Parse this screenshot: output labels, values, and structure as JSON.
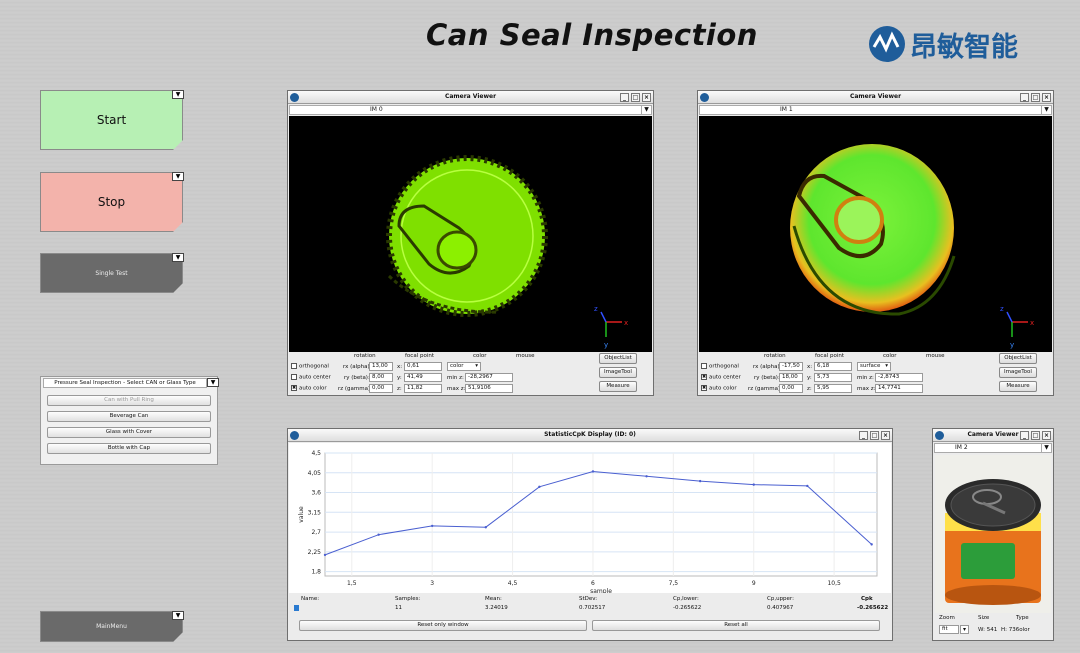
{
  "header": {
    "title": "Can Seal Inspection",
    "logo_text": "昂敏智能"
  },
  "left_buttons": {
    "start": "Start",
    "stop": "Stop",
    "single_test": "Single Test",
    "main_menu": "MainMenu",
    "dropdown_glyph": "▼"
  },
  "colors": {
    "start": "#b7f0b4",
    "stop": "#f3b3ab",
    "dark_button": "#6a6a6a",
    "accent": "#1f5d9a",
    "plot_line": "#4a5fd0"
  },
  "camera_viewer_1": {
    "title": "Camera Viewer",
    "image": "IM 0",
    "labels": {
      "rotation": "rotation",
      "focal_point": "focal point",
      "color": "color",
      "mouse": "mouse"
    },
    "checks": [
      {
        "label": "orthogonal",
        "checked": false,
        "mark": ""
      },
      {
        "label": "auto center",
        "checked": false,
        "mark": ""
      },
      {
        "label": "auto color",
        "checked": true,
        "mark": "✖"
      }
    ],
    "rx_label": "rx (alpha):",
    "rx": "13,00",
    "ry_label": "ry (beta):",
    "ry": "8,00",
    "rz_label": "rz (gamma):",
    "rz": "0,00",
    "x_label": "x:",
    "x": "0,61",
    "y_label": "y:",
    "y": "41,49",
    "z_label": "z:",
    "z": "11,82",
    "color_mode": "color",
    "min_z_label": "min z:",
    "min_z": "-28,2967",
    "max_z_label": "max z:",
    "max_z": "51,9106",
    "buttons": [
      "ObjectList",
      "ImageTool",
      "Measure"
    ]
  },
  "camera_viewer_2": {
    "title": "Camera Viewer",
    "image": "IM 1",
    "labels": {
      "rotation": "rotation",
      "focal_point": "focal point",
      "color": "color",
      "mouse": "mouse"
    },
    "checks": [
      {
        "label": "orthogonal",
        "checked": false,
        "mark": ""
      },
      {
        "label": "auto center",
        "checked": true,
        "mark": "✖"
      },
      {
        "label": "auto color",
        "checked": true,
        "mark": "✖"
      }
    ],
    "rx_label": "rx (alpha):",
    "rx": "-17,50",
    "ry_label": "ry (beta):",
    "ry": "18,00",
    "rz_label": "rz (gamma):",
    "rz": "0,00",
    "x_label": "x:",
    "x": "6,18",
    "y_label": "y:",
    "y": "5,73",
    "z_label": "z:",
    "z": "5,95",
    "color_mode": "surface",
    "min_z_label": "min z:",
    "min_z": "-2,8743",
    "max_z_label": "max z:",
    "max_z": "14,7741",
    "buttons": [
      "ObjectList",
      "ImageTool",
      "Measure"
    ]
  },
  "camera_viewer_3": {
    "title": "Camera Viewer",
    "image": "IM 2",
    "zoom_label": "Zoom",
    "zoom": "fit",
    "size_label": "Size",
    "size": "W: 541",
    "type_label": "Type",
    "type": "H: 736olor"
  },
  "axis_glyphs": {
    "x": "x",
    "y": "y",
    "z": "z"
  },
  "glyphs": {
    "minimize": "_",
    "maximize": "□",
    "close": "×",
    "dropdown": "▾"
  },
  "seal_panel": {
    "title": "Pressure Seal Inspection - Select CAN or Glass Type",
    "items": [
      {
        "label": "Can with Pull Ring",
        "disabled": true
      },
      {
        "label": "Beverage Can",
        "disabled": false
      },
      {
        "label": "Glass with Cover",
        "disabled": false
      },
      {
        "label": "Bottle with Cap",
        "disabled": false
      }
    ]
  },
  "stats": {
    "title": "StatisticCpK Display  (ID: 0)",
    "headers": [
      "Name:",
      "Samples:",
      "Mean:",
      "StDev:",
      "Cp,lower:",
      "Cp,upper:",
      "Cpk"
    ],
    "values": [
      "",
      "11",
      "3.24019",
      "0.702517",
      "-0.265622",
      "0.407967",
      "-0.265622"
    ],
    "reset_window": "Reset only window",
    "reset_all": "Reset all"
  },
  "chart_data": {
    "type": "line",
    "xlabel": "sample",
    "ylabel": "value",
    "xlim": [
      1,
      11.3
    ],
    "ylim": [
      1.7,
      4.5
    ],
    "xticks": [
      1.5,
      3,
      4.5,
      6,
      7.5,
      9,
      10.5
    ],
    "xtick_labels": [
      "1,5",
      "3",
      "4,5",
      "6",
      "7,5",
      "9",
      "10,5"
    ],
    "yticks": [
      1.8,
      2.25,
      2.7,
      3.15,
      3.6,
      4.05,
      4.5
    ],
    "ytick_labels": [
      "1,8",
      "2,25",
      "2,7",
      "3,15",
      "3,6",
      "4,05",
      "4,5"
    ],
    "grid": true,
    "x": [
      1,
      2,
      3,
      4,
      5,
      6,
      7,
      8,
      9,
      10,
      11.2
    ],
    "values": [
      2.18,
      2.64,
      2.84,
      2.81,
      3.73,
      4.08,
      3.97,
      3.86,
      3.78,
      3.75,
      2.42
    ]
  }
}
